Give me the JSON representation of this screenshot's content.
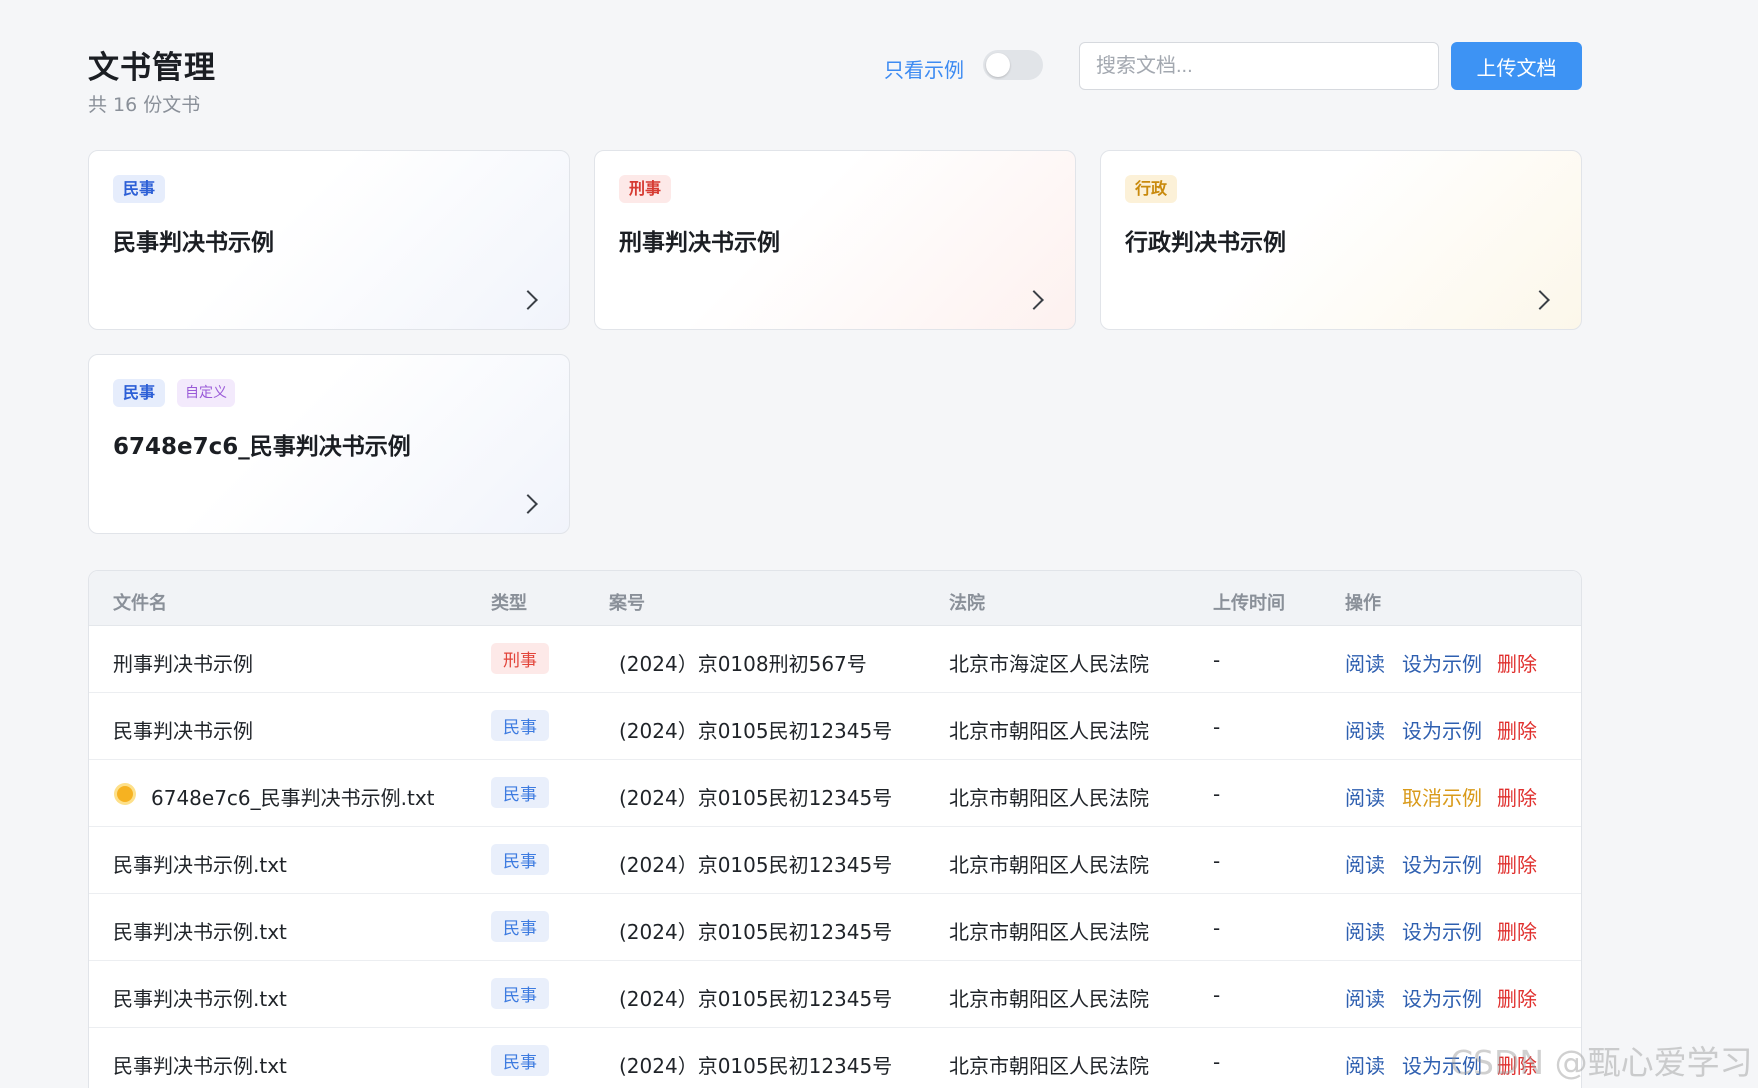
{
  "header": {
    "title": "文书管理",
    "subtitle": "共 16 份文书",
    "toggle_label": "只看示例",
    "search_placeholder": "搜索文档...",
    "upload_label": "上传文档"
  },
  "cards": [
    {
      "tags": [
        "民事"
      ],
      "title": "民事判决书示例"
    },
    {
      "tags": [
        "刑事"
      ],
      "title": "刑事判决书示例"
    },
    {
      "tags": [
        "行政"
      ],
      "title": "行政判决书示例"
    },
    {
      "tags": [
        "民事",
        "自定义"
      ],
      "title": "6748e7c6_民事判决书示例"
    }
  ],
  "table": {
    "columns": [
      "文件名",
      "类型",
      "案号",
      "法院",
      "上传时间",
      "操作"
    ],
    "rows": [
      {
        "name": "刑事判决书示例",
        "type": "刑事",
        "case_no": "(2024）京0108刑初567号",
        "court": "北京市海淀区人民法院",
        "time": "-",
        "read": "阅读",
        "set": "设为示例",
        "del": "删除"
      },
      {
        "name": "民事判决书示例",
        "type": "民事",
        "case_no": "(2024）京0105民初12345号",
        "court": "北京市朝阳区人民法院",
        "time": "-",
        "read": "阅读",
        "set": "设为示例",
        "del": "删除"
      },
      {
        "name": "6748e7c6_民事判决书示例.txt",
        "type": "民事",
        "case_no": "(2024）京0105民初12345号",
        "court": "北京市朝阳区人民法院",
        "time": "-",
        "read": "阅读",
        "set": "取消示例",
        "del": "删除"
      },
      {
        "name": "民事判决书示例.txt",
        "type": "民事",
        "case_no": "(2024）京0105民初12345号",
        "court": "北京市朝阳区人民法院",
        "time": "-",
        "read": "阅读",
        "set": "设为示例",
        "del": "删除"
      },
      {
        "name": "民事判决书示例.txt",
        "type": "民事",
        "case_no": "(2024）京0105民初12345号",
        "court": "北京市朝阳区人民法院",
        "time": "-",
        "read": "阅读",
        "set": "设为示例",
        "del": "删除"
      },
      {
        "name": "民事判决书示例.txt",
        "type": "民事",
        "case_no": "(2024）京0105民初12345号",
        "court": "北京市朝阳区人民法院",
        "time": "-",
        "read": "阅读",
        "set": "设为示例",
        "del": "删除"
      },
      {
        "name": "民事判决书示例.txt",
        "type": "民事",
        "case_no": "(2024）京0105民初12345号",
        "court": "北京市朝阳区人民法院",
        "time": "-",
        "read": "阅读",
        "set": "设为示例",
        "del": "删除"
      }
    ]
  },
  "watermark": "CSDN @甄心爱学习"
}
